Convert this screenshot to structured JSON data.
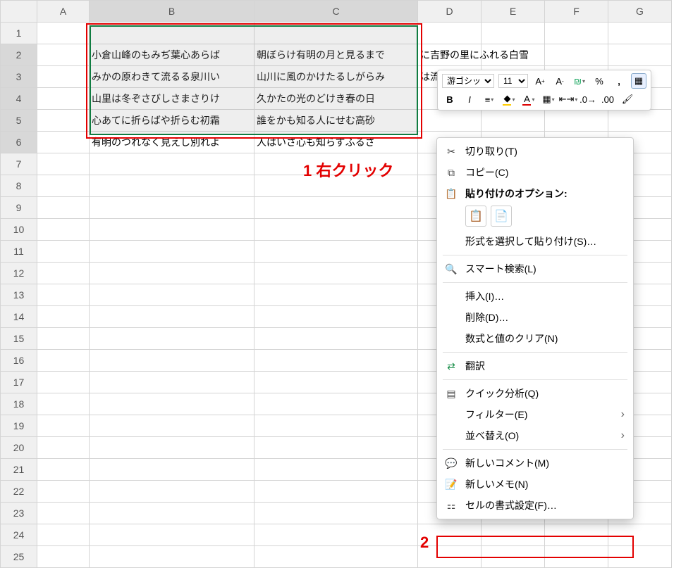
{
  "columns": [
    "A",
    "B",
    "C",
    "D",
    "E",
    "F",
    "G"
  ],
  "row_count": 25,
  "cells": {
    "B2": "小倉山峰のもみぢ葉心あらば",
    "C2": "朝ぼらけ有明の月と見るまで",
    "D2": "に吉野の里にふれる白雪",
    "B3": "みかの原わきて流るる泉川い",
    "C3": "山川に風のかけたるしがらみ",
    "D3": "は流れもあへぬもみぢなりけり",
    "B4": "山里は冬ぞさびしさまさりけ",
    "C4": "久かたの光のどけき春の日",
    "B5": "心あてに折らばや折らむ初霜",
    "C5": "誰をかも知る人にせむ高砂",
    "B6": "有明のつれなく見えし別れよ",
    "C6": "人はいさ心も知らずふるさ"
  },
  "mini_toolbar": {
    "font_name": "游ゴシック",
    "font_size": "11",
    "icons_row1": [
      "increase-font",
      "decrease-font",
      "accounting-format",
      "percent-format",
      "comma-format",
      "conditional-format"
    ],
    "icons_row2": [
      "bold",
      "italic",
      "align",
      "fill-color",
      "font-color",
      "borders",
      "merge",
      "increase-decimal",
      "decrease-decimal",
      "format-painter"
    ]
  },
  "context_menu": {
    "cut": "切り取り(T)",
    "copy": "コピー(C)",
    "paste_label": "貼り付けのオプション:",
    "paste_special": "形式を選択して貼り付け(S)…",
    "smart_lookup": "スマート検索(L)",
    "insert": "挿入(I)…",
    "delete": "削除(D)…",
    "clear": "数式と値のクリア(N)",
    "translate": "翻訳",
    "quick_analysis": "クイック分析(Q)",
    "filter": "フィルター(E)",
    "sort": "並べ替え(O)",
    "new_comment": "新しいコメント(M)",
    "new_note": "新しいメモ(N)",
    "format_cells": "セルの書式設定(F)…"
  },
  "annotations": {
    "label1": "1 右クリック",
    "label2": "2"
  }
}
